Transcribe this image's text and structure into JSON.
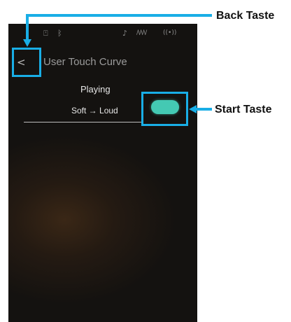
{
  "status_bar": {
    "usb_icon": "usb-icon",
    "bluetooth_icon": "bluetooth-icon",
    "mic_icon": "microphone-icon",
    "wave_icon": "audio-wave-icon",
    "wifi_icon": "wireless-icon"
  },
  "header": {
    "back_icon": "chevron-left-icon",
    "title": "User Touch Curve"
  },
  "content": {
    "mode_label": "Playing",
    "curve_label": "Soft → Loud",
    "start_button_color": "#44c9b3"
  },
  "annotations": {
    "back_label": "Back Taste",
    "start_label": "Start Taste",
    "highlight_color": "#19aee6"
  }
}
